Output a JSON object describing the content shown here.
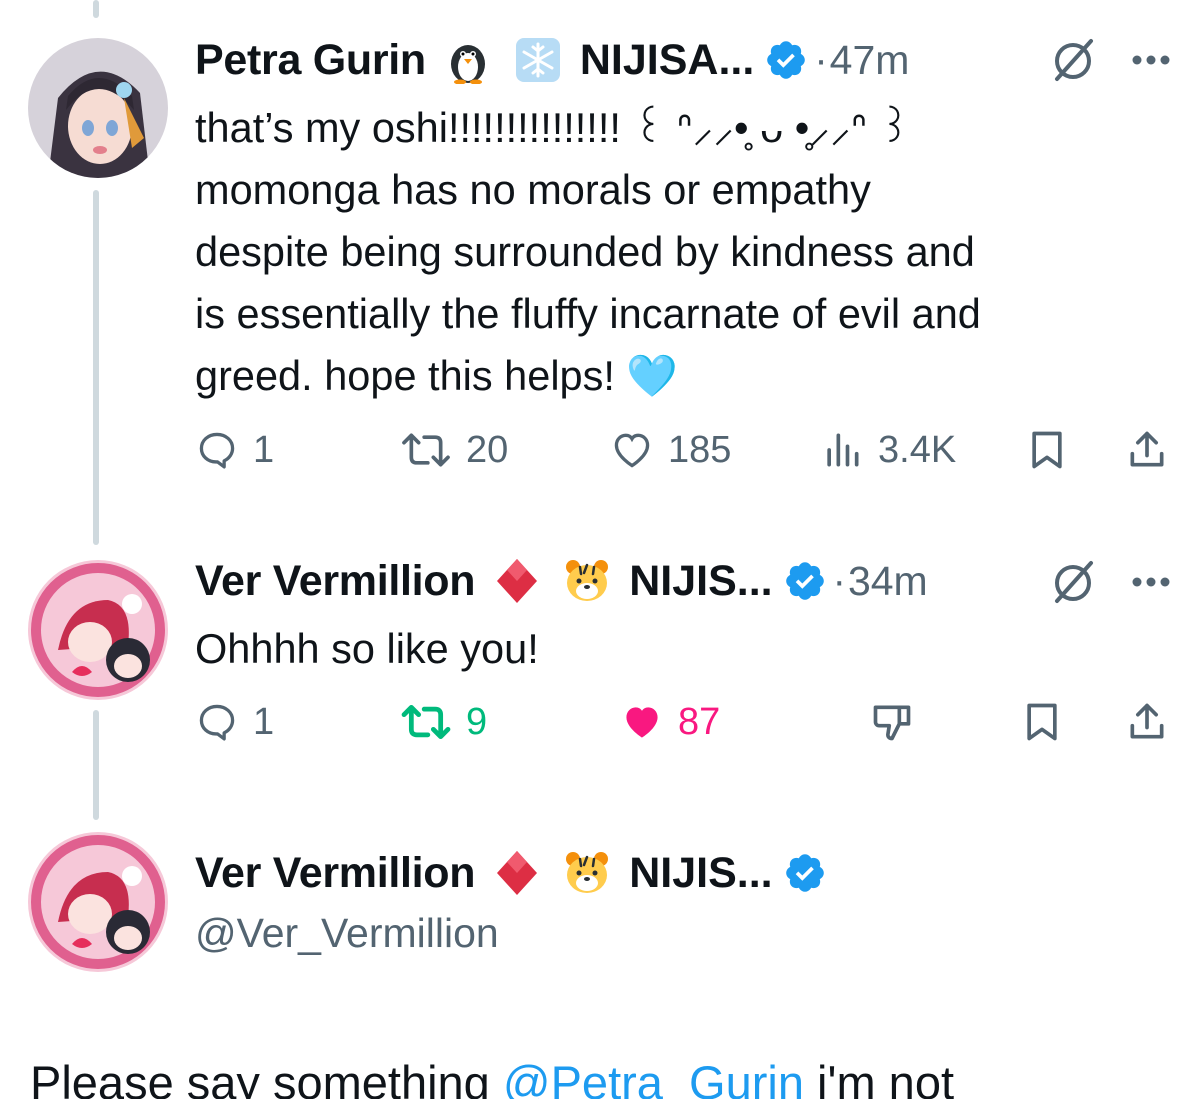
{
  "thread": [
    {
      "author": {
        "display_name": "Petra Gurin",
        "emoji_1": "penguin-emoji",
        "emoji_2": "snowflake-emoji",
        "affiliation": "NIJISA...",
        "verified": true
      },
      "separator": "·",
      "time": "47m",
      "text_lines": [
        "that’s my oshi!!!!!!!!!!!!!!! ꒰ ᐢ⸝⸝•̥ ᴗ •̥⸝⸝ᐢ ꒱",
        "momonga has no morals or empathy",
        "despite being surrounded by kindness and",
        "is essentially the fluffy incarnate of evil and",
        "greed. hope this helps! 🩵"
      ],
      "stats": {
        "replies": "1",
        "reposts": "20",
        "likes": "185",
        "views": "3.4K"
      },
      "colors": {
        "avatar_bg": "#c9c6cf"
      }
    },
    {
      "author": {
        "display_name": "Ver Vermillion",
        "emoji_1": "red-diamond-emoji",
        "emoji_2": "tiger-face-emoji",
        "affiliation": "NIJIS...",
        "verified": true
      },
      "separator": "·",
      "time": "34m",
      "text_lines": [
        "Ohhhh so like you!"
      ],
      "stats": {
        "replies": "1",
        "reposts": "9",
        "likes": "87"
      },
      "reposted_by_viewer": true,
      "liked_by_viewer": true,
      "colors": {
        "avatar_bg": "#f3c5d6"
      }
    },
    {
      "author": {
        "display_name": "Ver Vermillion",
        "emoji_1": "red-diamond-emoji",
        "emoji_2": "tiger-face-emoji",
        "affiliation": "NIJIS...",
        "verified": true,
        "handle": "@Ver_Vermillion"
      },
      "text_prefix": "Please say something ",
      "mention": "@Petra_Gurin",
      "text_suffix": " i'm not"
    }
  ],
  "colors": {
    "verified_blue": "#1d9bf0",
    "repost_green": "#00ba7c",
    "like_pink": "#f91880",
    "secondary_text": "#536471",
    "thread_line": "#cfd9de"
  }
}
